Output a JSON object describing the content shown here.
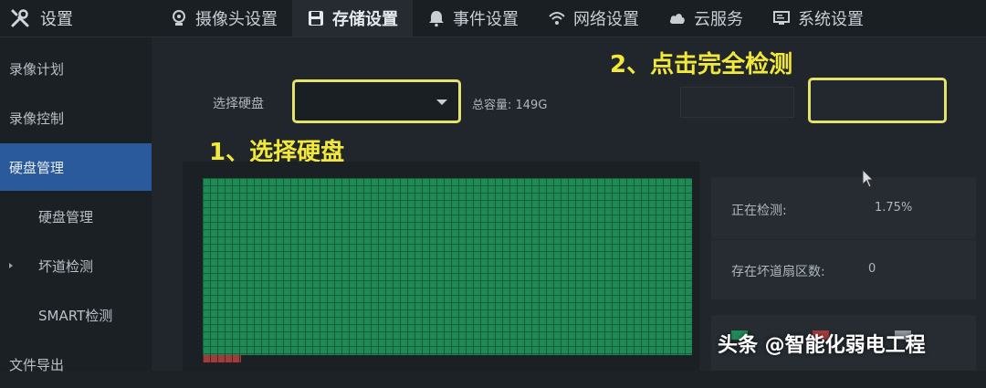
{
  "header": {
    "title": "设置",
    "tabs": [
      {
        "label": "摄像头设置",
        "icon": "camera-icon"
      },
      {
        "label": "存储设置",
        "icon": "save-icon",
        "active": true
      },
      {
        "label": "事件设置",
        "icon": "bell-icon"
      },
      {
        "label": "网络设置",
        "icon": "wifi-icon"
      },
      {
        "label": "云服务",
        "icon": "cloud-icon"
      },
      {
        "label": "系统设置",
        "icon": "monitor-icon"
      }
    ]
  },
  "sidebar": {
    "items": [
      {
        "label": "录像计划"
      },
      {
        "label": "录像控制"
      },
      {
        "label": "硬盘管理",
        "active": true
      },
      {
        "label": "硬盘管理"
      },
      {
        "label": "坏道检测"
      },
      {
        "label": "SMART检测"
      },
      {
        "label": "文件导出"
      }
    ]
  },
  "disk": {
    "select_label": "选择硬盘",
    "select_value": "",
    "capacity": "总容量: 149G"
  },
  "status": {
    "checking_label": "正在检测:",
    "checking_value": "1.75%",
    "bad_label": "存在坏道扇区数:",
    "bad_value": "0"
  },
  "annotations": {
    "step1": "1、选择硬盘",
    "step2": "2、点击完全检测"
  },
  "colors": {
    "highlight": "#e3e26a",
    "annotation": "#f2e83a",
    "active_blue": "#2a5a9c",
    "good_sector": "#1f8a55",
    "bad_sector": "#a23b3b"
  },
  "watermark": "头条 @智能化弱电工程"
}
